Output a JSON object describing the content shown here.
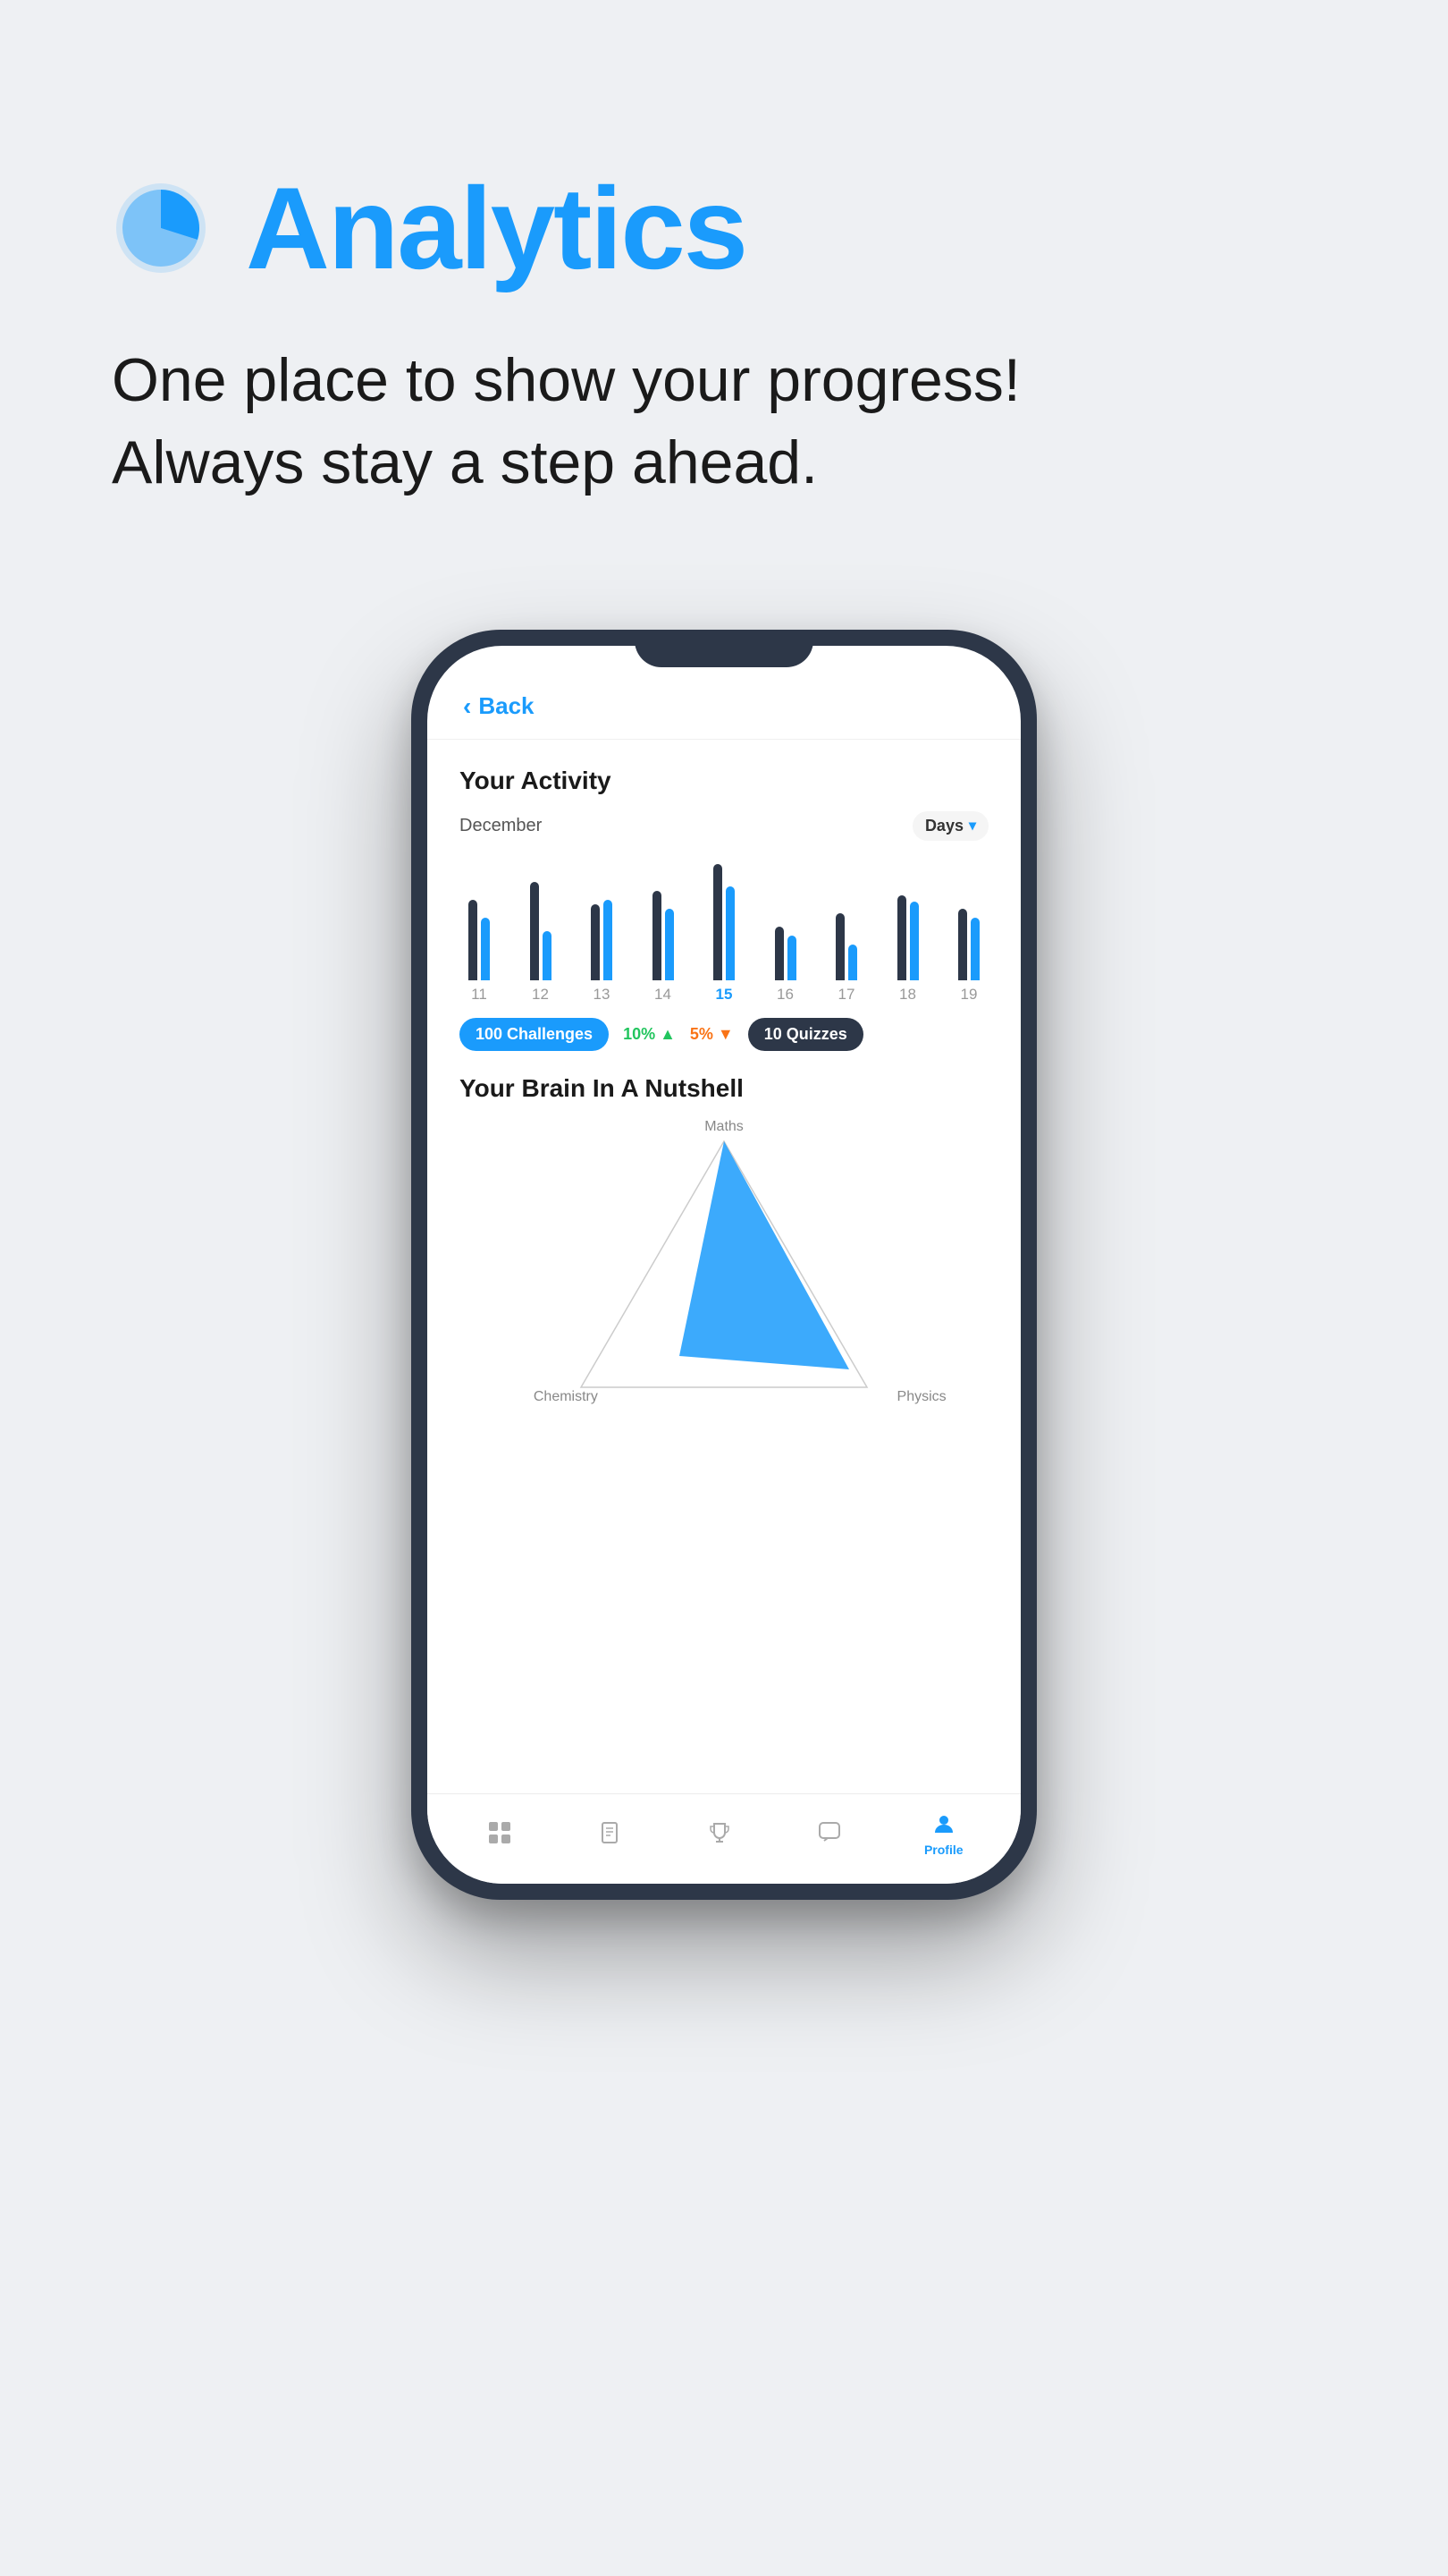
{
  "hero": {
    "title": "Analytics",
    "subtitle_line1": "One place to show your progress!",
    "subtitle_line2": "Always stay a step ahead.",
    "icon_label": "analytics-pie-icon"
  },
  "phone": {
    "back_label": "Back",
    "sections": {
      "activity": {
        "title": "Your Activity",
        "month": "December",
        "filter": "Days",
        "bars": [
          {
            "day": "11",
            "dark_h": 90,
            "blue_h": 70,
            "active": false
          },
          {
            "day": "12",
            "dark_h": 110,
            "blue_h": 55,
            "active": false
          },
          {
            "day": "13",
            "dark_h": 85,
            "blue_h": 90,
            "active": false
          },
          {
            "day": "14",
            "dark_h": 100,
            "blue_h": 80,
            "active": false
          },
          {
            "day": "15",
            "dark_h": 130,
            "blue_h": 105,
            "active": true
          },
          {
            "day": "16",
            "dark_h": 60,
            "blue_h": 50,
            "active": false
          },
          {
            "day": "17",
            "dark_h": 75,
            "blue_h": 40,
            "active": false
          },
          {
            "day": "18",
            "dark_h": 95,
            "blue_h": 88,
            "active": false
          },
          {
            "day": "19",
            "dark_h": 80,
            "blue_h": 70,
            "active": false
          }
        ],
        "stats": [
          {
            "label": "100 Challenges",
            "type": "blue"
          },
          {
            "label": "10%",
            "change": "up"
          },
          {
            "label": "5%",
            "change": "down"
          },
          {
            "label": "10 Quizzes",
            "type": "dark"
          }
        ]
      },
      "brain": {
        "title": "Your Brain In A Nutshell",
        "labels": {
          "top": "Maths",
          "left": "Chemistry",
          "right": "Physics"
        }
      }
    },
    "nav": [
      {
        "icon": "grid-icon",
        "label": "",
        "active": false
      },
      {
        "icon": "book-icon",
        "label": "",
        "active": false
      },
      {
        "icon": "trophy-icon",
        "label": "",
        "active": false
      },
      {
        "icon": "chat-icon",
        "label": "",
        "active": false
      },
      {
        "icon": "profile-icon",
        "label": "Profile",
        "active": true
      }
    ]
  }
}
